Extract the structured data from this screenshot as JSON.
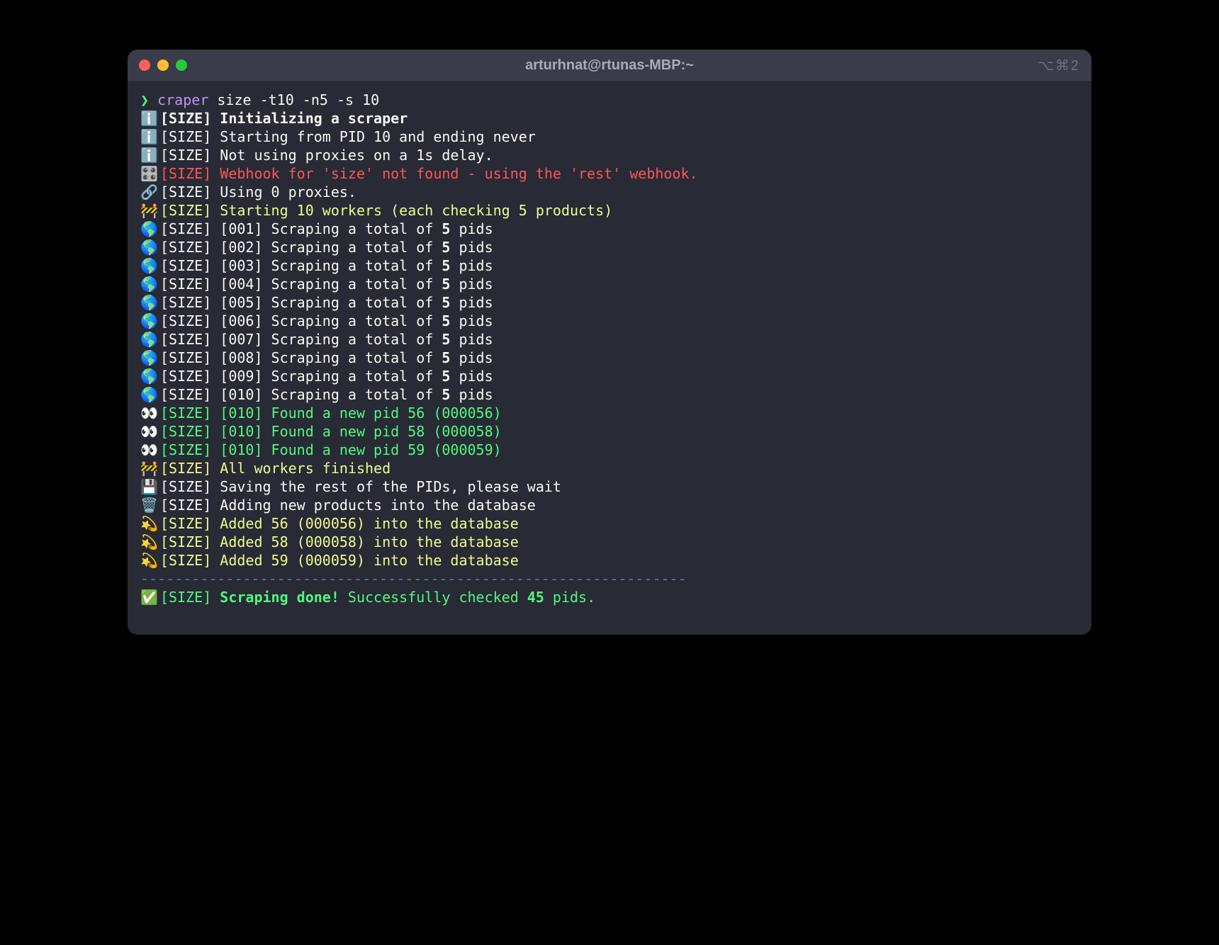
{
  "window": {
    "title": "arturhnat@rtunas-MBP:~",
    "shortcut": "⌥⌘2"
  },
  "prompt": {
    "caret": "❯",
    "cmd": "craper",
    "args": "size -t10 -n5 -s 10"
  },
  "lines": [
    {
      "emoji": "ℹ️",
      "color": "c-default",
      "bold": true,
      "prefix": "[SIZE] ",
      "text": "Initializing a scraper"
    },
    {
      "emoji": "ℹ️",
      "color": "c-default",
      "bold": false,
      "prefix": "[SIZE] ",
      "text": "Starting from PID 10 and ending never"
    },
    {
      "emoji": "ℹ️",
      "color": "c-default",
      "bold": false,
      "prefix": "[SIZE] ",
      "text": "Not using proxies on a 1s delay."
    },
    {
      "emoji": "🎛️",
      "color": "c-red",
      "bold": false,
      "prefix": "[SIZE] ",
      "text": "Webhook for 'size' not found - using the 'rest' webhook."
    },
    {
      "emoji": "🔗",
      "color": "c-default",
      "bold": false,
      "prefix": "[SIZE] ",
      "text": "Using 0 proxies."
    },
    {
      "emoji": "🚧",
      "color": "c-yellow",
      "bold": false,
      "prefix": "[SIZE] ",
      "text": "Starting 10 workers (each checking 5 products)"
    },
    {
      "emoji": "🌎",
      "color": "c-default",
      "bold": false,
      "prefix": "[SIZE] [001] ",
      "text_pre": "Scraping a total of ",
      "text_bold": "5",
      "text_post": " pids"
    },
    {
      "emoji": "🌎",
      "color": "c-default",
      "bold": false,
      "prefix": "[SIZE] [002] ",
      "text_pre": "Scraping a total of ",
      "text_bold": "5",
      "text_post": " pids"
    },
    {
      "emoji": "🌎",
      "color": "c-default",
      "bold": false,
      "prefix": "[SIZE] [003] ",
      "text_pre": "Scraping a total of ",
      "text_bold": "5",
      "text_post": " pids"
    },
    {
      "emoji": "🌎",
      "color": "c-default",
      "bold": false,
      "prefix": "[SIZE] [004] ",
      "text_pre": "Scraping a total of ",
      "text_bold": "5",
      "text_post": " pids"
    },
    {
      "emoji": "🌎",
      "color": "c-default",
      "bold": false,
      "prefix": "[SIZE] [005] ",
      "text_pre": "Scraping a total of ",
      "text_bold": "5",
      "text_post": " pids"
    },
    {
      "emoji": "🌎",
      "color": "c-default",
      "bold": false,
      "prefix": "[SIZE] [006] ",
      "text_pre": "Scraping a total of ",
      "text_bold": "5",
      "text_post": " pids"
    },
    {
      "emoji": "🌎",
      "color": "c-default",
      "bold": false,
      "prefix": "[SIZE] [007] ",
      "text_pre": "Scraping a total of ",
      "text_bold": "5",
      "text_post": " pids"
    },
    {
      "emoji": "🌎",
      "color": "c-default",
      "bold": false,
      "prefix": "[SIZE] [008] ",
      "text_pre": "Scraping a total of ",
      "text_bold": "5",
      "text_post": " pids"
    },
    {
      "emoji": "🌎",
      "color": "c-default",
      "bold": false,
      "prefix": "[SIZE] [009] ",
      "text_pre": "Scraping a total of ",
      "text_bold": "5",
      "text_post": " pids"
    },
    {
      "emoji": "🌎",
      "color": "c-default",
      "bold": false,
      "prefix": "[SIZE] [010] ",
      "text_pre": "Scraping a total of ",
      "text_bold": "5",
      "text_post": " pids"
    },
    {
      "emoji": "👀",
      "color": "c-green",
      "bold": false,
      "prefix": "[SIZE] [010] ",
      "text": "Found a new pid 56 (000056)"
    },
    {
      "emoji": "👀",
      "color": "c-green",
      "bold": false,
      "prefix": "[SIZE] [010] ",
      "text": "Found a new pid 58 (000058)"
    },
    {
      "emoji": "👀",
      "color": "c-green",
      "bold": false,
      "prefix": "[SIZE] [010] ",
      "text": "Found a new pid 59 (000059)"
    },
    {
      "emoji": "🚧",
      "color": "c-yellow",
      "bold": false,
      "prefix": "[SIZE] ",
      "text": "All workers finished"
    },
    {
      "emoji": "💾",
      "color": "c-default",
      "bold": false,
      "prefix": "[SIZE] ",
      "text": "Saving the rest of the PIDs, please wait"
    },
    {
      "emoji": "🗑️",
      "color": "c-default",
      "bold": false,
      "prefix": "[SIZE] ",
      "text": "Adding new products into the database"
    },
    {
      "emoji": "💫",
      "color": "c-yellow",
      "bold": false,
      "prefix": "[SIZE] ",
      "text": "Added 56 (000056) into the database"
    },
    {
      "emoji": "💫",
      "color": "c-yellow",
      "bold": false,
      "prefix": "[SIZE] ",
      "text": "Added 58 (000058) into the database"
    },
    {
      "emoji": "💫",
      "color": "c-yellow",
      "bold": false,
      "prefix": "[SIZE] ",
      "text": "Added 59 (000059) into the database"
    }
  ],
  "separator": "----------------------------------------------------------------",
  "done": {
    "emoji": "✅",
    "prefix": "[SIZE] ",
    "bold_part": "Scraping done!",
    "rest_pre": " Successfully checked ",
    "rest_bold": "45",
    "rest_post": " pids."
  }
}
